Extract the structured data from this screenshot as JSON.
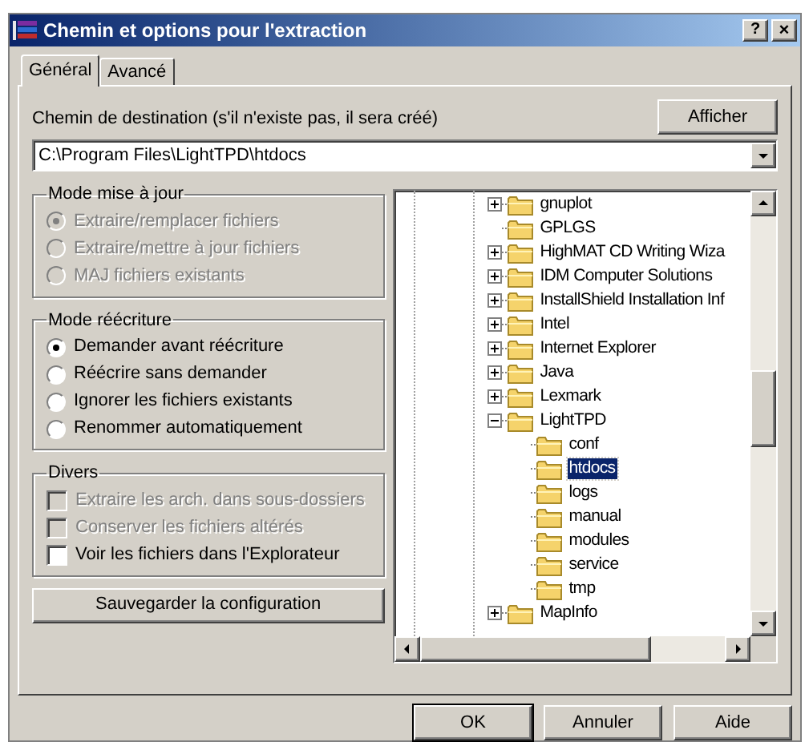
{
  "window": {
    "title": "Chemin et options pour l'extraction",
    "help_button": "?",
    "close_button": "×"
  },
  "tabs": [
    {
      "label": "Général",
      "selected": true
    },
    {
      "label": "Avancé",
      "selected": false
    }
  ],
  "destination": {
    "label": "Chemin de destination (s'il n'existe pas, il sera créé)",
    "button": "Afficher",
    "value": "C:\\Program Files\\LightTPD\\htdocs"
  },
  "groups": [
    {
      "title": "Mode mise à jour",
      "kind": "radio",
      "options": [
        {
          "label": "Extraire/remplacer fichiers",
          "selected": true,
          "disabled": true
        },
        {
          "label": "Extraire/mettre à jour fichiers",
          "selected": false,
          "disabled": true
        },
        {
          "label": "MAJ fichiers existants",
          "selected": false,
          "disabled": true
        }
      ]
    },
    {
      "title": "Mode réécriture",
      "kind": "radio",
      "options": [
        {
          "label": "Demander avant réécriture",
          "selected": true,
          "disabled": false
        },
        {
          "label": "Réécrire sans demander",
          "selected": false,
          "disabled": false
        },
        {
          "label": "Ignorer les fichiers existants",
          "selected": false,
          "disabled": false
        },
        {
          "label": "Renommer automatiquement",
          "selected": false,
          "disabled": false
        }
      ]
    },
    {
      "title": "Divers",
      "kind": "checkbox",
      "options": [
        {
          "label": "Extraire les arch. dans sous-dossiers",
          "checked": false,
          "disabled": true
        },
        {
          "label": "Conserver les fichiers altérés",
          "checked": false,
          "disabled": true
        },
        {
          "label": "Voir les fichiers dans l'Explorateur",
          "checked": false,
          "disabled": false
        }
      ]
    }
  ],
  "save_button": "Sauvegarder la configuration",
  "tree": [
    {
      "label": "gnuplot",
      "kind": "collapsed",
      "selected": false
    },
    {
      "label": "GPLGS",
      "kind": "leaf",
      "selected": false
    },
    {
      "label": "HighMAT CD Writing Wiza",
      "kind": "collapsed",
      "selected": false
    },
    {
      "label": "IDM Computer Solutions",
      "kind": "collapsed",
      "selected": false
    },
    {
      "label": "InstallShield Installation Inf",
      "kind": "collapsed",
      "selected": false
    },
    {
      "label": "Intel",
      "kind": "collapsed",
      "selected": false
    },
    {
      "label": "Internet Explorer",
      "kind": "collapsed",
      "selected": false
    },
    {
      "label": "Java",
      "kind": "collapsed",
      "selected": false
    },
    {
      "label": "Lexmark",
      "kind": "collapsed",
      "selected": false
    },
    {
      "label": "LightTPD",
      "kind": "expanded",
      "selected": false,
      "children": [
        {
          "label": "conf",
          "kind": "leaf",
          "selected": false
        },
        {
          "label": "htdocs",
          "kind": "leaf",
          "selected": true
        },
        {
          "label": "logs",
          "kind": "leaf",
          "selected": false
        },
        {
          "label": "manual",
          "kind": "leaf",
          "selected": false
        },
        {
          "label": "modules",
          "kind": "leaf",
          "selected": false
        },
        {
          "label": "service",
          "kind": "leaf",
          "selected": false
        },
        {
          "label": "tmp",
          "kind": "leaf",
          "selected": false
        }
      ]
    },
    {
      "label": "MapInfo",
      "kind": "collapsed",
      "selected": false
    }
  ],
  "buttons": [
    {
      "label": "OK",
      "default": true
    },
    {
      "label": "Annuler",
      "default": false
    },
    {
      "label": "Aide",
      "default": false
    }
  ]
}
